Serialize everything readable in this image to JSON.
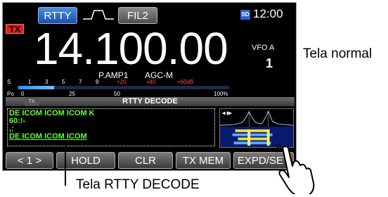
{
  "status": {
    "tx": "TX",
    "mode": "RTTY",
    "filter": "FIL2",
    "sd": "SD",
    "time": "12:00"
  },
  "frequency": "14.100.00",
  "vfo": {
    "label": "VFO A",
    "number": "1"
  },
  "indicators": {
    "preamp": "P.AMP1",
    "agc": "AGC-M"
  },
  "meter": {
    "s_label": "S",
    "s_scale": [
      "1",
      "3",
      "5",
      "7",
      "9"
    ],
    "s_over": [
      "+20",
      "+40",
      "+60dB"
    ],
    "po_label": "Po",
    "po_scale": [
      "0",
      "25",
      "50",
      "100%"
    ],
    "level_percent": 17
  },
  "decode": {
    "title": "RTTY DECODE",
    "tx": "TX",
    "lines": [
      "DE ICOM ICOM ICOM K",
      "60:!-",
      ",:",
      "DE ICOM ICOM ICOM"
    ]
  },
  "buttons": [
    "< 1 >",
    "HOLD",
    "CLR",
    "TX MEM",
    "EXPD/SET"
  ],
  "labels": {
    "normal": "Tela normal",
    "decode": "Tela RTTY DECODE"
  },
  "colors": {
    "decode_text": "#66ff33",
    "tx": "#dd2222",
    "mode_button": "#2a63c4"
  },
  "icons": [
    "filter-shape-icon",
    "sd-card-icon",
    "hand-pointer-icon"
  ]
}
